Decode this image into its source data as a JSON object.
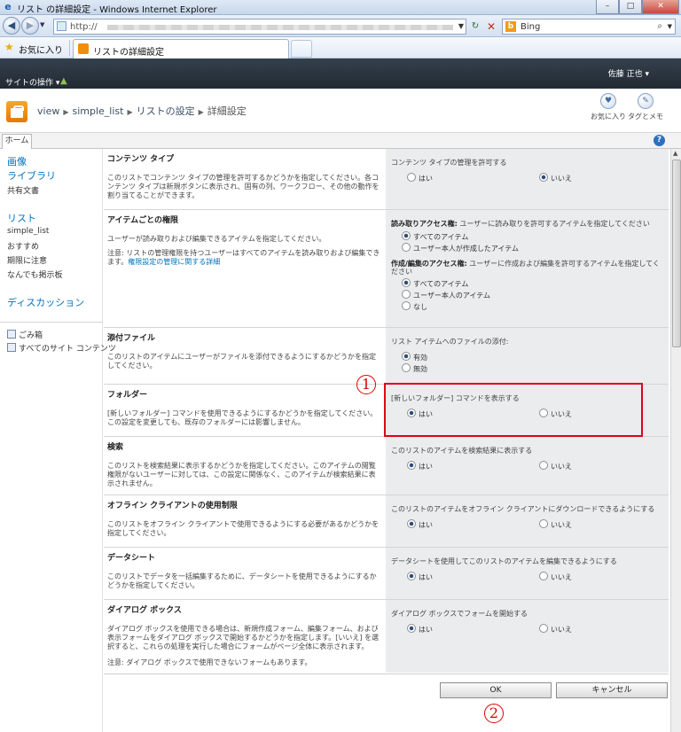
{
  "window": {
    "title": "リスト の詳細設定 - Windows Internet Explorer",
    "min": "–",
    "max": "□",
    "close": "✕"
  },
  "address": {
    "protocol": "http://",
    "search_engine": "Bing"
  },
  "favorites": {
    "label": "お気に入り",
    "tab_title": "リストの詳細設定"
  },
  "sp": {
    "site_actions": "サイトの操作 ▾",
    "user": "佐藤 正也 ▾",
    "breadcrumb": [
      "view",
      "simple_list",
      "リストの設定"
    ],
    "breadcrumb_current": "詳細設定",
    "like_label": "お気に入り",
    "tags_label": "タグとメモ",
    "home_tab": "ホーム",
    "help": "?"
  },
  "nav": {
    "images": "画像",
    "library": "ライブラリ",
    "shared_docs": "共有文書",
    "lists": "リスト",
    "simple_list": "simple_list",
    "recommend": "おすすめ",
    "deadline": "期限に注意",
    "board": "なんでも掲示板",
    "discussion": "ディスカッション",
    "recycle": "ごみ箱",
    "all_content": "すべてのサイト コンテンツ"
  },
  "sections": {
    "content_type": {
      "title": "コンテンツ タイプ",
      "text": "このリストでコンテンツ タイプの管理を許可するかどうかを指定してください。各コンテンツ タイプは新規ボタンに表示され、固有の列、ワークフロー、その他の動作を割り当てることができます。",
      "label": "コンテンツ タイプの管理を許可する",
      "yes": "はい",
      "no": "いいえ"
    },
    "item_perm": {
      "title": "アイテムごとの権限",
      "text1": "ユーザーが読み取りおよび編集できるアイテムを指定してください。",
      "text2": "注意: リストの管理権限を持つユーザーはすべてのアイテムを読み取りおよび編集できます。",
      "link": "権限設定の管理に関する詳細",
      "read_label_bold": "読み取りアクセス権:",
      "read_label": "ユーザーに読み取りを許可するアイテムを指定してください",
      "read_all": "すべてのアイテム",
      "read_own": "ユーザー本人が作成したアイテム",
      "edit_label_bold": "作成/編集のアクセス権:",
      "edit_label": "ユーザーに作成および編集を許可するアイテムを指定してください",
      "edit_all": "すべてのアイテム",
      "edit_own": "ユーザー本人のアイテム",
      "edit_none": "なし"
    },
    "attachments": {
      "title": "添付ファイル",
      "text": "このリストのアイテムにユーザーがファイルを添付できるようにするかどうかを指定してください。",
      "label": "リスト アイテムへのファイルの添付:",
      "enabled": "有効",
      "disabled": "無効"
    },
    "folder": {
      "title": "フォルダー",
      "text": "[新しいフォルダー] コマンドを使用できるようにするかどうかを指定してください。この設定を変更しても、既存のフォルダーには影響しません。",
      "label": "[新しいフォルダー] コマンドを表示する",
      "yes": "はい",
      "no": "いいえ"
    },
    "search": {
      "title": "検索",
      "text": "このリストを検索結果に表示するかどうかを指定してください。このアイテムの閲覧権限がないユーザーに対しては、この設定に関係なく、このアイテムが検索結果に表示されません。",
      "label": "このリストのアイテムを検索結果に表示する",
      "yes": "はい",
      "no": "いいえ"
    },
    "offline": {
      "title": "オフライン クライアントの使用制限",
      "text": "このリストをオフライン クライアントで使用できるようにする必要があるかどうかを指定してください。",
      "label": "このリストのアイテムをオフライン クライアントにダウンロードできるようにする",
      "yes": "はい",
      "no": "いいえ"
    },
    "datasheet": {
      "title": "データシート",
      "text": "このリストでデータを一括編集するために、データシートを使用できるようにするかどうかを指定してください。",
      "label": "データシートを使用してこのリストのアイテムを編集できるようにする",
      "yes": "はい",
      "no": "いいえ"
    },
    "dialog": {
      "title": "ダイアログ ボックス",
      "text": "ダイアログ ボックスを使用できる場合は、新規作成フォーム、編集フォーム、および表示フォームをダイアログ ボックスで開始するかどうかを指定します。[いいえ] を選択すると、これらの処理を実行した場合にフォームがページ全体に表示されます。",
      "note": "注意: ダイアログ ボックスで使用できないフォームもあります。",
      "label": "ダイアログ ボックスでフォームを開始する",
      "yes": "はい",
      "no": "いいえ"
    }
  },
  "buttons": {
    "ok": "OK",
    "cancel": "キャンセル"
  },
  "annotations": {
    "marker1": "1",
    "marker2": "2"
  }
}
